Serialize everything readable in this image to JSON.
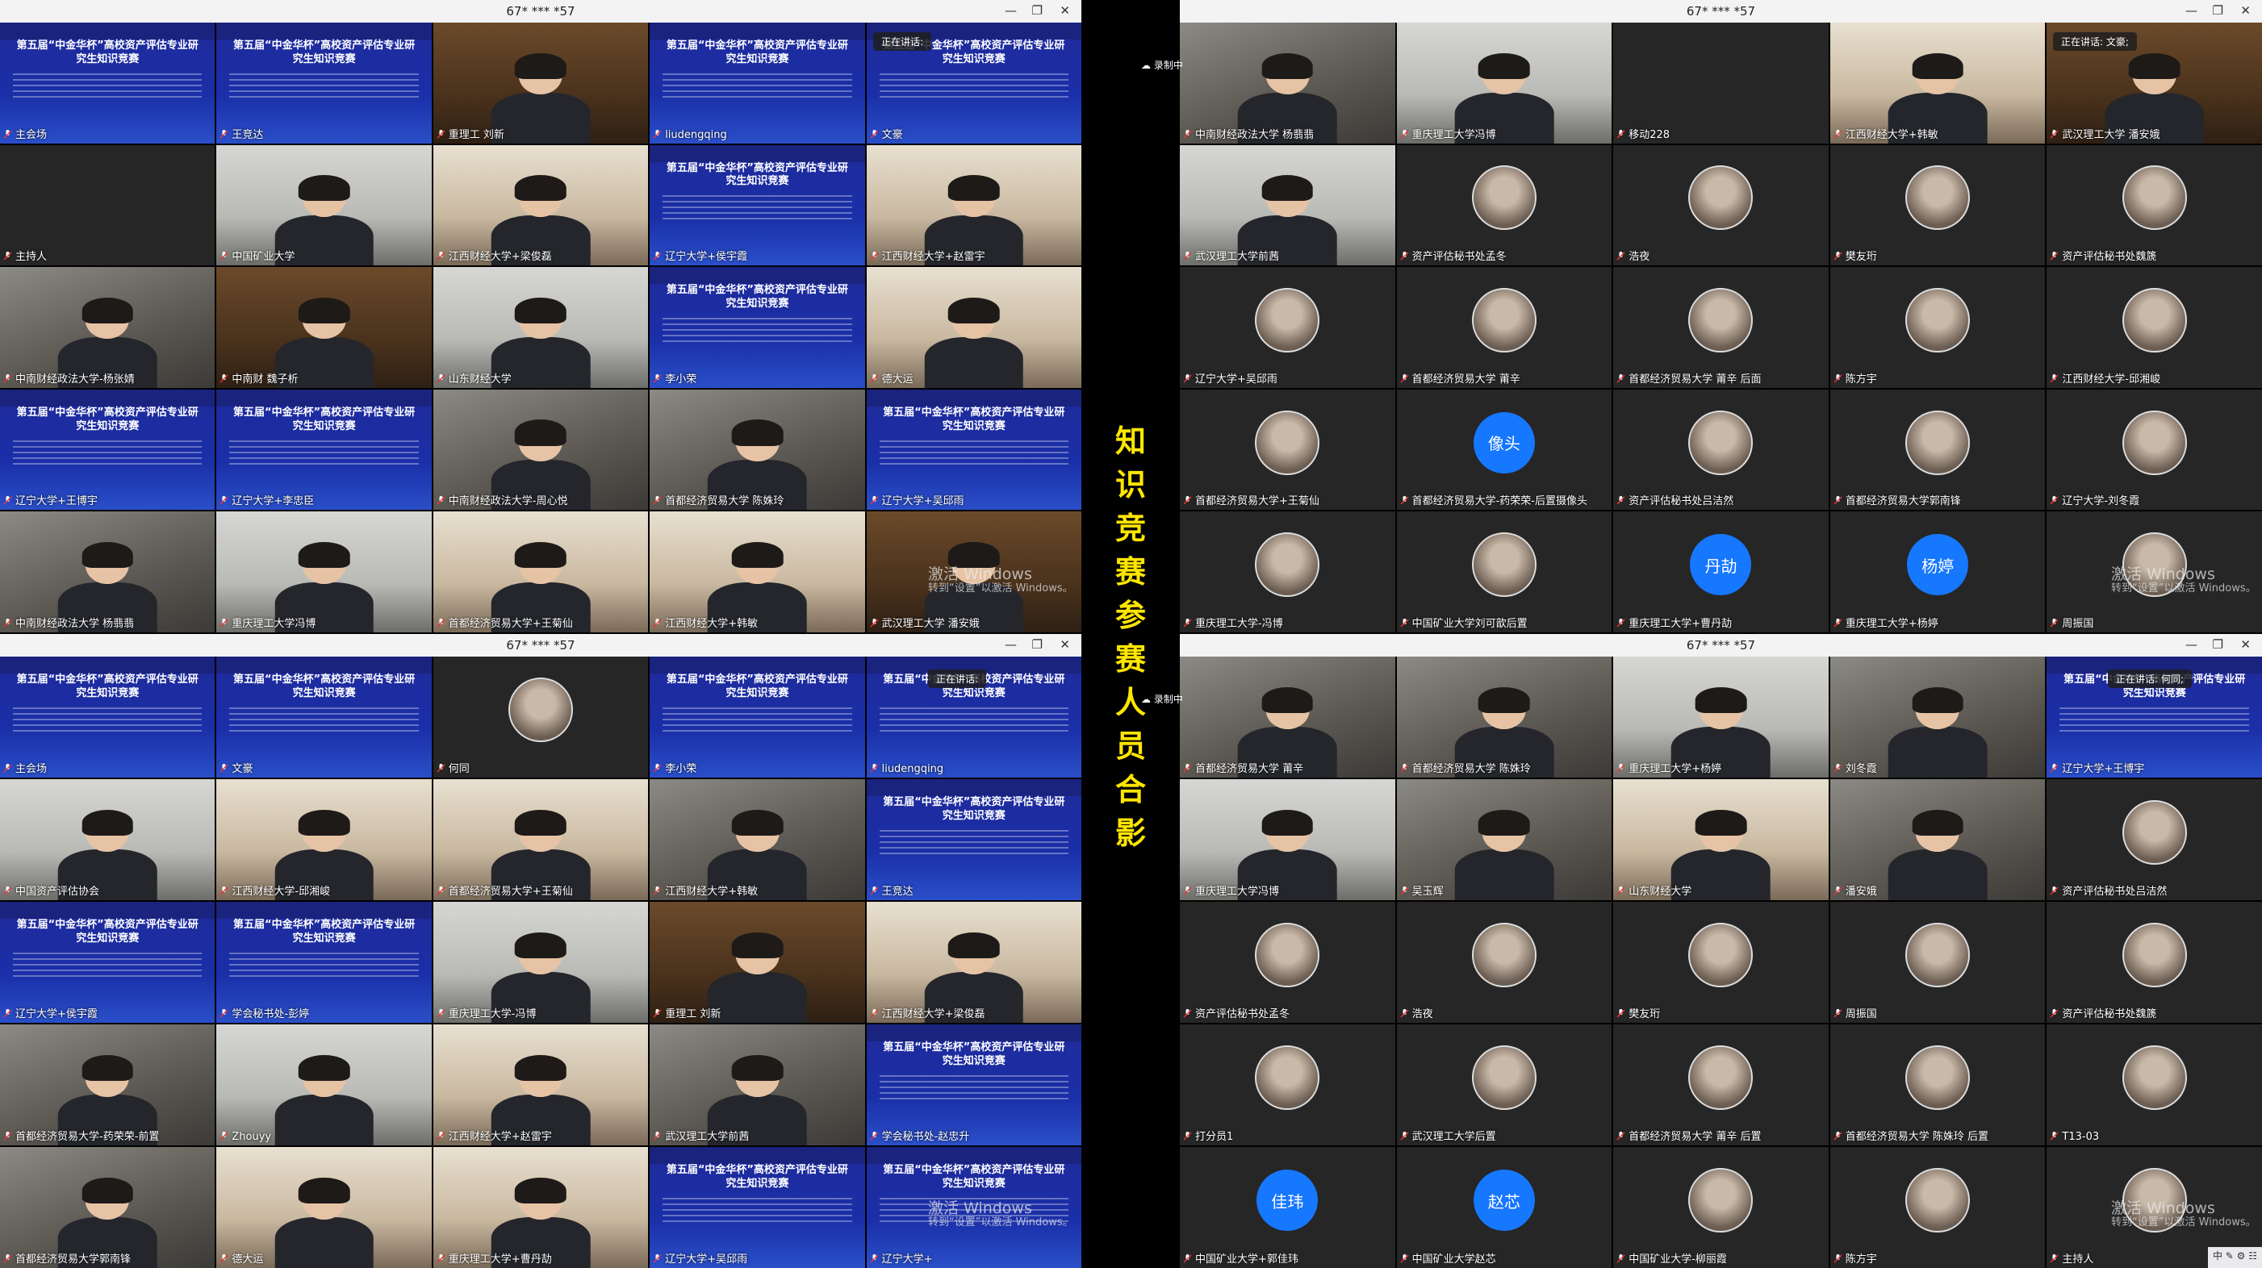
{
  "windows": [
    {
      "title": "67* *** *57"
    },
    {
      "title": "67* *** *57"
    },
    {
      "title": "67* *** *57"
    },
    {
      "title": "67* *** *57"
    }
  ],
  "overlay_title": "知识竞赛参赛人员合影",
  "status": {
    "speaking_label_q1": "正在讲话:",
    "speaking_label_q2": "正在讲话: 文豪;",
    "speaking_label_q3": "正在讲话:",
    "speaking_label_q4": "正在讲话: 何同;",
    "recording": "录制中"
  },
  "slide": {
    "title": "第五届“中金华杯”高校资产评估专业研究生知识竞赛",
    "date": "2022.12.10"
  },
  "watermark": {
    "main": "激活 Windows",
    "sub": "转到“设置”以激活 Windows。"
  },
  "taskbar": {
    "ime": "中"
  },
  "q1": [
    {
      "name": "主会场",
      "kind": "scr"
    },
    {
      "name": "王竞达",
      "kind": "scr"
    },
    {
      "name": "重理工 刘新",
      "kind": "shelf"
    },
    {
      "name": "liudengqing",
      "kind": "scr"
    },
    {
      "name": "文豪",
      "kind": "scr"
    },
    {
      "name": "主持人",
      "kind": "dark"
    },
    {
      "name": "中国矿业大学",
      "kind": "room"
    },
    {
      "name": "江西财经大学+梁俊磊",
      "kind": "warm"
    },
    {
      "name": "辽宁大学+侯宇霞",
      "kind": "scr"
    },
    {
      "name": "江西财经大学+赵雷宇",
      "kind": "warm"
    },
    {
      "name": "中南财经政法大学-杨张婧",
      "kind": "cam"
    },
    {
      "name": "中南财 魏子析",
      "kind": "shelf"
    },
    {
      "name": "山东财经大学",
      "kind": "room"
    },
    {
      "name": "李小荣",
      "kind": "scr"
    },
    {
      "name": "德大运",
      "kind": "warm"
    },
    {
      "name": "辽宁大学+王博宇",
      "kind": "scr"
    },
    {
      "name": "辽宁大学+李忠臣",
      "kind": "scr"
    },
    {
      "name": "中南财经政法大学-周心悦",
      "kind": "cam"
    },
    {
      "name": "首都经济贸易大学 陈姝玲",
      "kind": "cam"
    },
    {
      "name": "辽宁大学+吴邱雨",
      "kind": "scr"
    },
    {
      "name": "中南财经政法大学 杨翡翡",
      "kind": "cam"
    },
    {
      "name": "重庆理工大学冯博",
      "kind": "room"
    },
    {
      "name": "首都经济贸易大学+王菊仙",
      "kind": "warm"
    },
    {
      "name": "江西财经大学+韩敏",
      "kind": "warm"
    },
    {
      "name": "武汉理工大学 潘安娥",
      "kind": "shelf"
    }
  ],
  "q2": [
    {
      "name": "中南财经政法大学 杨翡翡",
      "kind": "cam"
    },
    {
      "name": "重庆理工大学冯博",
      "kind": "room"
    },
    {
      "name": "移动228",
      "kind": "dark"
    },
    {
      "name": "江西财经大学+韩敏",
      "kind": "warm"
    },
    {
      "name": "武汉理工大学 潘安娥",
      "kind": "shelf"
    },
    {
      "name": "武汉理工大学前茜",
      "kind": "room"
    },
    {
      "name": "资产评估秘书处孟冬",
      "kind": "dark",
      "avatar": "img"
    },
    {
      "name": "浩夜",
      "kind": "dark",
      "avatar": "img"
    },
    {
      "name": "樊友珩",
      "kind": "dark",
      "avatar": "img"
    },
    {
      "name": "资产评估秘书处魏篪",
      "kind": "dark",
      "avatar": "img"
    },
    {
      "name": "辽宁大学+吴邱雨",
      "kind": "dark",
      "avatar": "img"
    },
    {
      "name": "首都经济贸易大学 莆辛",
      "kind": "dark",
      "avatar": "img"
    },
    {
      "name": "首都经济贸易大学 莆辛 后面",
      "kind": "dark",
      "avatar": "img"
    },
    {
      "name": "陈方宇",
      "kind": "dark",
      "avatar": "img"
    },
    {
      "name": "江西财经大学-邱湘峻",
      "kind": "dark",
      "avatar": "img"
    },
    {
      "name": "首都经济贸易大学+王菊仙",
      "kind": "dark",
      "avatar": "img"
    },
    {
      "name": "首都经济贸易大学-药荣荣-后置摄像头",
      "kind": "dark",
      "avatar": "像头"
    },
    {
      "name": "资产评估秘书处吕洁然",
      "kind": "dark",
      "avatar": "img"
    },
    {
      "name": "首都经济贸易大学郭南锋",
      "kind": "dark",
      "avatar": "img"
    },
    {
      "name": "辽宁大学-刘冬霞",
      "kind": "dark",
      "avatar": "img"
    },
    {
      "name": "重庆理工大学-冯博",
      "kind": "dark",
      "avatar": "img"
    },
    {
      "name": "中国矿业大学刘可歆后置",
      "kind": "dark",
      "avatar": "img"
    },
    {
      "name": "重庆理工大学+曹丹劼",
      "kind": "dark",
      "avatar": "丹劼"
    },
    {
      "name": "重庆理工大学+杨婷",
      "kind": "dark",
      "avatar": "杨婷"
    },
    {
      "name": "周振国",
      "kind": "dark",
      "avatar": "img"
    }
  ],
  "q3": [
    {
      "name": "主会场",
      "kind": "scr"
    },
    {
      "name": "文豪",
      "kind": "scr"
    },
    {
      "name": "何同",
      "kind": "dark",
      "avatar": "img"
    },
    {
      "name": "李小荣",
      "kind": "scr"
    },
    {
      "name": "liudengqing",
      "kind": "scr"
    },
    {
      "name": "中国资产评估协会",
      "kind": "room"
    },
    {
      "name": "江西财经大学-邱湘峻",
      "kind": "warm"
    },
    {
      "name": "首都经济贸易大学+王菊仙",
      "kind": "warm"
    },
    {
      "name": "江西财经大学+韩敏",
      "kind": "cam"
    },
    {
      "name": "王竞达",
      "kind": "scr"
    },
    {
      "name": "辽宁大学+侯宇霞",
      "kind": "scr"
    },
    {
      "name": "学会秘书处-彭婷",
      "kind": "scr"
    },
    {
      "name": "重庆理工大学-冯博",
      "kind": "room"
    },
    {
      "name": "重理工 刘新",
      "kind": "shelf"
    },
    {
      "name": "江西财经大学+梁俊磊",
      "kind": "warm"
    },
    {
      "name": "首都经济贸易大学-药荣荣-前置",
      "kind": "cam"
    },
    {
      "name": "Zhouyy",
      "kind": "room"
    },
    {
      "name": "江西财经大学+赵雷宇",
      "kind": "warm"
    },
    {
      "name": "武汉理工大学前茜",
      "kind": "cam"
    },
    {
      "name": "学会秘书处-赵忠升",
      "kind": "scr"
    },
    {
      "name": "首都经济贸易大学郭南锋",
      "kind": "cam"
    },
    {
      "name": "德大运",
      "kind": "warm"
    },
    {
      "name": "重庆理工大学+曹丹劼",
      "kind": "warm"
    },
    {
      "name": "辽宁大学+吴邱雨",
      "kind": "scr"
    },
    {
      "name": "辽宁大学+",
      "kind": "scr"
    }
  ],
  "q4": [
    {
      "name": "首都经济贸易大学 莆辛",
      "kind": "cam"
    },
    {
      "name": "首都经济贸易大学 陈姝玲",
      "kind": "cam"
    },
    {
      "name": "重庆理工大学+杨婷",
      "kind": "room"
    },
    {
      "name": "刘冬霞",
      "kind": "cam"
    },
    {
      "name": "辽宁大学+王博宇",
      "kind": "scr"
    },
    {
      "name": "重庆理工大学冯博",
      "kind": "room"
    },
    {
      "name": "吴玉辉",
      "kind": "cam"
    },
    {
      "name": "山东财经大学",
      "kind": "warm"
    },
    {
      "name": "潘安娥",
      "kind": "cam"
    },
    {
      "name": "资产评估秘书处吕洁然",
      "kind": "dark",
      "avatar": "img"
    },
    {
      "name": "资产评估秘书处孟冬",
      "kind": "dark",
      "avatar": "img"
    },
    {
      "name": "浩夜",
      "kind": "dark",
      "avatar": "img"
    },
    {
      "name": "樊友珩",
      "kind": "dark",
      "avatar": "img"
    },
    {
      "name": "周振国",
      "kind": "dark",
      "avatar": "img"
    },
    {
      "name": "资产评估秘书处魏篪",
      "kind": "dark",
      "avatar": "img"
    },
    {
      "name": "打分员1",
      "kind": "dark",
      "avatar": "img"
    },
    {
      "name": "武汉理工大学后置",
      "kind": "dark",
      "avatar": "img"
    },
    {
      "name": "首都经济贸易大学 莆辛 后置",
      "kind": "dark",
      "avatar": "img"
    },
    {
      "name": "首都经济贸易大学 陈姝玲 后置",
      "kind": "dark",
      "avatar": "img"
    },
    {
      "name": "T13-03",
      "kind": "dark",
      "avatar": "img"
    },
    {
      "name": "中国矿业大学+郭佳玮",
      "kind": "dark",
      "avatar": "佳玮"
    },
    {
      "name": "中国矿业大学赵芯",
      "kind": "dark",
      "avatar": "赵芯"
    },
    {
      "name": "中国矿业大学-柳丽霞",
      "kind": "dark",
      "avatar": "img"
    },
    {
      "name": "陈方宇",
      "kind": "dark",
      "avatar": "img"
    },
    {
      "name": "主持人",
      "kind": "dark",
      "avatar": "img"
    }
  ],
  "colors": {
    "accent": "#1677ff",
    "title_yellow": "#ffe600",
    "slide_blue": "#1a2fa8"
  }
}
